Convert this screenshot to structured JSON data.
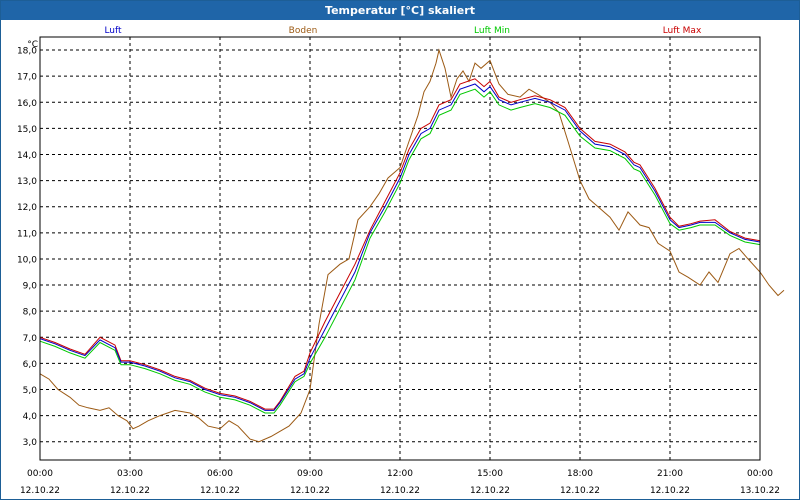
{
  "window": {
    "title": "Temperatur [°C] skaliert"
  },
  "chart_data": {
    "type": "line",
    "title": "Temperatur [°C] skaliert",
    "ylabel": "°C",
    "xlabel": "",
    "ylim": [
      2.3,
      18.5
    ],
    "yticks": [
      3.0,
      4.0,
      5.0,
      6.0,
      7.0,
      8.0,
      9.0,
      10.0,
      11.0,
      12.0,
      13.0,
      14.0,
      15.0,
      16.0,
      17.0,
      18.0
    ],
    "ytick_labels": [
      "3,0",
      "4,0",
      "5,0",
      "6,0",
      "7,0",
      "8,0",
      "9,0",
      "10,0",
      "11,0",
      "12,0",
      "13,0",
      "14,0",
      "15,0",
      "16,0",
      "17,0",
      "18,0"
    ],
    "xlim_hours": [
      0,
      24
    ],
    "xticks": [
      {
        "h": 0,
        "time": "00:00",
        "date": "12.10.22"
      },
      {
        "h": 3,
        "time": "03:00",
        "date": "12.10.22"
      },
      {
        "h": 6,
        "time": "06:00",
        "date": "12.10.22"
      },
      {
        "h": 9,
        "time": "09:00",
        "date": "12.10.22"
      },
      {
        "h": 12,
        "time": "12:00",
        "date": "12.10.22"
      },
      {
        "h": 15,
        "time": "15:00",
        "date": "12.10.22"
      },
      {
        "h": 18,
        "time": "18:00",
        "date": "12.10.22"
      },
      {
        "h": 21,
        "time": "21:00",
        "date": "12.10.22"
      },
      {
        "h": 24,
        "time": "00:00",
        "date": "13.10.22"
      }
    ],
    "grid": true,
    "legend_position": "top",
    "series": [
      {
        "name": "Luft",
        "color": "#0000c8",
        "points": [
          [
            0,
            6.95
          ],
          [
            0.5,
            6.75
          ],
          [
            1,
            6.5
          ],
          [
            1.5,
            6.3
          ],
          [
            2,
            6.9
          ],
          [
            2.5,
            6.6
          ],
          [
            2.7,
            6.05
          ],
          [
            3,
            6.05
          ],
          [
            3.5,
            5.9
          ],
          [
            4,
            5.7
          ],
          [
            4.5,
            5.45
          ],
          [
            5,
            5.3
          ],
          [
            5.5,
            5.0
          ],
          [
            6,
            4.8
          ],
          [
            6.5,
            4.7
          ],
          [
            7,
            4.5
          ],
          [
            7.5,
            4.2
          ],
          [
            7.8,
            4.2
          ],
          [
            8,
            4.5
          ],
          [
            8.5,
            5.4
          ],
          [
            8.8,
            5.6
          ],
          [
            9,
            6.2
          ],
          [
            9.5,
            7.3
          ],
          [
            10,
            8.4
          ],
          [
            10.5,
            9.5
          ],
          [
            11,
            11.0
          ],
          [
            11.5,
            12.0
          ],
          [
            12,
            13.1
          ],
          [
            12.3,
            14.0
          ],
          [
            12.7,
            14.8
          ],
          [
            13,
            15.0
          ],
          [
            13.3,
            15.7
          ],
          [
            13.7,
            15.9
          ],
          [
            14,
            16.5
          ],
          [
            14.5,
            16.7
          ],
          [
            14.8,
            16.4
          ],
          [
            15,
            16.6
          ],
          [
            15.3,
            16.1
          ],
          [
            15.7,
            15.9
          ],
          [
            16,
            16.0
          ],
          [
            16.5,
            16.15
          ],
          [
            17,
            16.0
          ],
          [
            17.5,
            15.7
          ],
          [
            18,
            14.9
          ],
          [
            18.5,
            14.4
          ],
          [
            19,
            14.3
          ],
          [
            19.5,
            14.0
          ],
          [
            19.8,
            13.6
          ],
          [
            20,
            13.5
          ],
          [
            20.5,
            12.6
          ],
          [
            21,
            11.5
          ],
          [
            21.3,
            11.2
          ],
          [
            21.7,
            11.3
          ],
          [
            22,
            11.4
          ],
          [
            22.5,
            11.4
          ],
          [
            23,
            11.0
          ],
          [
            23.5,
            10.75
          ],
          [
            24,
            10.65
          ]
        ]
      },
      {
        "name": "Boden",
        "color": "#9c5a14",
        "points": [
          [
            0,
            5.6
          ],
          [
            0.3,
            5.4
          ],
          [
            0.6,
            5.0
          ],
          [
            1,
            4.7
          ],
          [
            1.3,
            4.4
          ],
          [
            1.6,
            4.3
          ],
          [
            2,
            4.2
          ],
          [
            2.3,
            4.3
          ],
          [
            2.6,
            4.0
          ],
          [
            2.9,
            3.8
          ],
          [
            3.1,
            3.5
          ],
          [
            3.3,
            3.6
          ],
          [
            3.6,
            3.8
          ],
          [
            4,
            4.0
          ],
          [
            4.5,
            4.2
          ],
          [
            5,
            4.1
          ],
          [
            5.3,
            3.9
          ],
          [
            5.6,
            3.6
          ],
          [
            6,
            3.5
          ],
          [
            6.3,
            3.8
          ],
          [
            6.6,
            3.6
          ],
          [
            7,
            3.1
          ],
          [
            7.3,
            3.0
          ],
          [
            7.7,
            3.2
          ],
          [
            8,
            3.4
          ],
          [
            8.3,
            3.6
          ],
          [
            8.7,
            4.1
          ],
          [
            9,
            5.0
          ],
          [
            9.3,
            7.5
          ],
          [
            9.6,
            9.4
          ],
          [
            10,
            9.8
          ],
          [
            10.3,
            10.0
          ],
          [
            10.6,
            11.5
          ],
          [
            11,
            12.0
          ],
          [
            11.3,
            12.5
          ],
          [
            11.6,
            13.1
          ],
          [
            12,
            13.5
          ],
          [
            12.3,
            14.5
          ],
          [
            12.6,
            15.5
          ],
          [
            12.8,
            16.4
          ],
          [
            13,
            16.8
          ],
          [
            13.2,
            17.5
          ],
          [
            13.3,
            18.0
          ],
          [
            13.5,
            17.3
          ],
          [
            13.7,
            16.2
          ],
          [
            13.9,
            16.9
          ],
          [
            14.1,
            17.2
          ],
          [
            14.3,
            16.8
          ],
          [
            14.5,
            17.5
          ],
          [
            14.7,
            17.3
          ],
          [
            15,
            17.6
          ],
          [
            15.3,
            16.7
          ],
          [
            15.6,
            16.3
          ],
          [
            16,
            16.2
          ],
          [
            16.3,
            16.5
          ],
          [
            16.6,
            16.3
          ],
          [
            17,
            16.0
          ],
          [
            17.3,
            15.6
          ],
          [
            17.6,
            14.5
          ],
          [
            18,
            13.0
          ],
          [
            18.3,
            12.3
          ],
          [
            18.6,
            12.0
          ],
          [
            19,
            11.6
          ],
          [
            19.3,
            11.1
          ],
          [
            19.6,
            11.8
          ],
          [
            20,
            11.3
          ],
          [
            20.3,
            11.2
          ],
          [
            20.6,
            10.6
          ],
          [
            21,
            10.3
          ],
          [
            21.3,
            9.5
          ],
          [
            21.6,
            9.3
          ],
          [
            22,
            9.0
          ],
          [
            22.3,
            9.5
          ],
          [
            22.6,
            9.1
          ],
          [
            23,
            10.2
          ],
          [
            23.3,
            10.4
          ],
          [
            23.6,
            10.0
          ],
          [
            24,
            9.5
          ],
          [
            24.3,
            9.0
          ],
          [
            24.6,
            8.6
          ],
          [
            24.8,
            8.8
          ]
        ]
      },
      {
        "name": "Luft Min",
        "color": "#00c800",
        "points": [
          [
            0,
            6.85
          ],
          [
            0.5,
            6.65
          ],
          [
            1,
            6.4
          ],
          [
            1.5,
            6.2
          ],
          [
            2,
            6.8
          ],
          [
            2.5,
            6.5
          ],
          [
            2.7,
            5.95
          ],
          [
            3,
            5.95
          ],
          [
            3.5,
            5.8
          ],
          [
            4,
            5.6
          ],
          [
            4.5,
            5.35
          ],
          [
            5,
            5.2
          ],
          [
            5.5,
            4.9
          ],
          [
            6,
            4.7
          ],
          [
            6.5,
            4.6
          ],
          [
            7,
            4.4
          ],
          [
            7.5,
            4.1
          ],
          [
            7.8,
            4.1
          ],
          [
            8,
            4.4
          ],
          [
            8.5,
            5.3
          ],
          [
            8.8,
            5.5
          ],
          [
            9,
            6.0
          ],
          [
            9.5,
            7.0
          ],
          [
            10,
            8.1
          ],
          [
            10.5,
            9.2
          ],
          [
            11,
            10.8
          ],
          [
            11.5,
            11.8
          ],
          [
            12,
            12.9
          ],
          [
            12.3,
            13.8
          ],
          [
            12.7,
            14.6
          ],
          [
            13,
            14.8
          ],
          [
            13.3,
            15.5
          ],
          [
            13.7,
            15.7
          ],
          [
            14,
            16.3
          ],
          [
            14.5,
            16.5
          ],
          [
            14.8,
            16.2
          ],
          [
            15,
            16.4
          ],
          [
            15.3,
            15.9
          ],
          [
            15.7,
            15.7
          ],
          [
            16,
            15.8
          ],
          [
            16.5,
            15.95
          ],
          [
            17,
            15.8
          ],
          [
            17.5,
            15.5
          ],
          [
            18,
            14.7
          ],
          [
            18.5,
            14.25
          ],
          [
            19,
            14.15
          ],
          [
            19.5,
            13.85
          ],
          [
            19.8,
            13.45
          ],
          [
            20,
            13.35
          ],
          [
            20.5,
            12.45
          ],
          [
            21,
            11.35
          ],
          [
            21.3,
            11.1
          ],
          [
            21.7,
            11.2
          ],
          [
            22,
            11.3
          ],
          [
            22.5,
            11.3
          ],
          [
            23,
            10.9
          ],
          [
            23.5,
            10.65
          ],
          [
            24,
            10.55
          ]
        ]
      },
      {
        "name": "Luft Max",
        "color": "#c80000",
        "points": [
          [
            0,
            7.0
          ],
          [
            0.5,
            6.8
          ],
          [
            1,
            6.55
          ],
          [
            1.5,
            6.35
          ],
          [
            2,
            7.0
          ],
          [
            2.5,
            6.7
          ],
          [
            2.7,
            6.1
          ],
          [
            3,
            6.1
          ],
          [
            3.5,
            5.95
          ],
          [
            4,
            5.75
          ],
          [
            4.5,
            5.5
          ],
          [
            5,
            5.35
          ],
          [
            5.5,
            5.05
          ],
          [
            6,
            4.85
          ],
          [
            6.5,
            4.75
          ],
          [
            7,
            4.55
          ],
          [
            7.5,
            4.25
          ],
          [
            7.8,
            4.25
          ],
          [
            8,
            4.55
          ],
          [
            8.5,
            5.5
          ],
          [
            8.8,
            5.7
          ],
          [
            9,
            6.4
          ],
          [
            9.5,
            7.6
          ],
          [
            10,
            8.7
          ],
          [
            10.5,
            9.8
          ],
          [
            11,
            11.1
          ],
          [
            11.5,
            12.2
          ],
          [
            12,
            13.3
          ],
          [
            12.3,
            14.2
          ],
          [
            12.7,
            15.0
          ],
          [
            13,
            15.2
          ],
          [
            13.3,
            15.9
          ],
          [
            13.7,
            16.1
          ],
          [
            14,
            16.7
          ],
          [
            14.5,
            16.9
          ],
          [
            14.8,
            16.6
          ],
          [
            15,
            16.8
          ],
          [
            15.3,
            16.2
          ],
          [
            15.7,
            16.0
          ],
          [
            16,
            16.1
          ],
          [
            16.5,
            16.25
          ],
          [
            17,
            16.1
          ],
          [
            17.5,
            15.8
          ],
          [
            18,
            15.0
          ],
          [
            18.5,
            14.5
          ],
          [
            19,
            14.4
          ],
          [
            19.5,
            14.1
          ],
          [
            19.8,
            13.7
          ],
          [
            20,
            13.6
          ],
          [
            20.5,
            12.7
          ],
          [
            21,
            11.6
          ],
          [
            21.3,
            11.25
          ],
          [
            21.7,
            11.35
          ],
          [
            22,
            11.45
          ],
          [
            22.5,
            11.5
          ],
          [
            23,
            11.05
          ],
          [
            23.5,
            10.8
          ],
          [
            24,
            10.7
          ]
        ]
      }
    ]
  }
}
